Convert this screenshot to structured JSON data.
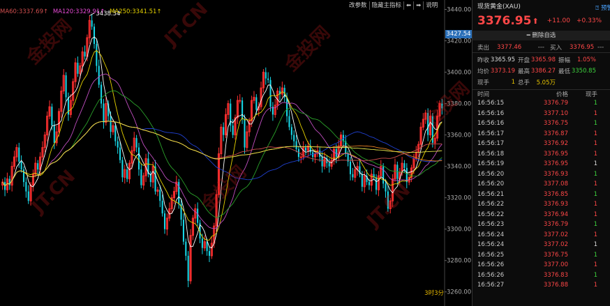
{
  "chart_data": {
    "type": "candlestick",
    "ma_legend": [
      {
        "label": "MA60:3337.69↑",
        "color": "#d04e4e"
      },
      {
        "label": "MA120:3329.91↑",
        "color": "#e64ad4"
      },
      {
        "label": "MA250:3341.51↑",
        "color": "#e6d200"
      }
    ],
    "y_ticks": [
      3260,
      3280,
      3300,
      3320,
      3340,
      3360,
      3380,
      3400,
      3420,
      3440
    ],
    "y_tick_labels": [
      "3260.00",
      "3280.00",
      "3300.00",
      "3320.00",
      "3340.00",
      "3360.00",
      "3380.00",
      "3400.00",
      "3420.00",
      "3440.00"
    ],
    "ylim": [
      3251,
      3446
    ],
    "current_price_tag": "3427.54",
    "high_annotation": "3438.54",
    "period_badge": "3时3分",
    "close": [
      3330,
      3325,
      3332,
      3328,
      3340,
      3346,
      3352,
      3343,
      3338,
      3330,
      3324,
      3318,
      3328,
      3335,
      3342,
      3338,
      3346,
      3352,
      3360,
      3372,
      3378,
      3366,
      3355,
      3362,
      3375,
      3388,
      3398,
      3384,
      3373,
      3382,
      3394,
      3406,
      3399,
      3404,
      3413,
      3410,
      3422,
      3433,
      3429,
      3418,
      3404,
      3392,
      3380,
      3368,
      3380,
      3372,
      3362,
      3366,
      3356,
      3352,
      3344,
      3333,
      3338,
      3332,
      3342,
      3350,
      3358,
      3352,
      3338,
      3328,
      3334,
      3345,
      3335,
      3330,
      3340,
      3324,
      3325,
      3318,
      3310,
      3300,
      3307,
      3313,
      3320,
      3324,
      3330,
      3316,
      3306,
      3292,
      3283,
      3267,
      3296,
      3307,
      3313,
      3304,
      3294,
      3288,
      3292,
      3286,
      3283,
      3291,
      3302,
      3322,
      3348,
      3365,
      3360,
      3373,
      3380,
      3366,
      3360,
      3371,
      3382,
      3382,
      3370,
      3352,
      3362,
      3369,
      3382,
      3384,
      3376,
      3378,
      3390,
      3400,
      3396,
      3395,
      3378,
      3373,
      3379,
      3388,
      3386,
      3390,
      3384,
      3372,
      3365,
      3360,
      3356,
      3351,
      3346,
      3346,
      3352,
      3350,
      3353,
      3349,
      3346,
      3348,
      3350,
      3346,
      3340,
      3345,
      3342,
      3340,
      3344,
      3351,
      3346,
      3353,
      3360,
      3356,
      3348,
      3343,
      3335,
      3333,
      3338,
      3340,
      3335,
      3327,
      3334,
      3330,
      3328,
      3335,
      3333,
      3325,
      3334,
      3340,
      3329,
      3324,
      3313,
      3318,
      3332,
      3341,
      3332,
      3336,
      3342,
      3339,
      3330,
      3333,
      3339,
      3345,
      3349,
      3354,
      3365,
      3370,
      3374,
      3360,
      3372,
      3355,
      3358,
      3372,
      3380,
      3377
    ]
  },
  "toolbar": {
    "params": "改参数",
    "hide_main": "隐藏主指标",
    "help": "说明"
  },
  "quote": {
    "name": "现货黄金(XAU)",
    "alert": "预警",
    "price": "3376.95",
    "arrow": "⬆",
    "change": "+11.00",
    "change_pct": "+0.33%",
    "remove_watch": "删除自选",
    "sell_label": "卖出",
    "sell_price": "3377.46",
    "sell_qty": "---",
    "buy_label": "买入",
    "buy_price": "3376.95",
    "buy_qty": "---",
    "stats": [
      {
        "l1": "昨收",
        "v1": "3365.95",
        "c1": "white",
        "l2": "开盘",
        "v2": "3365.98",
        "c2": "red",
        "l3": "振幅",
        "v3": "1.05%",
        "c3": "red"
      },
      {
        "l1": "均价",
        "v1": "3373.19",
        "c1": "red",
        "l2": "最高",
        "v2": "3386.27",
        "c2": "red",
        "l3": "最低",
        "v3": "3350.85",
        "c3": "green"
      },
      {
        "l1": "现手",
        "v1": "1",
        "c1": "yellow",
        "l2": "总手",
        "v2": "5.05万",
        "c2": "yellow",
        "l3": "",
        "v3": "",
        "c3": "white"
      }
    ],
    "ticks_header": {
      "time": "时间",
      "price": "价格",
      "vol": "现手"
    },
    "ticks": [
      {
        "time": "16:56:15",
        "price": "3376.79",
        "vol": "1",
        "pc": "red",
        "vc": "green"
      },
      {
        "time": "16:56:16",
        "price": "3377.10",
        "vol": "1",
        "pc": "red",
        "vc": "red"
      },
      {
        "time": "16:56:16",
        "price": "3376.75",
        "vol": "1",
        "pc": "red",
        "vc": "green"
      },
      {
        "time": "16:56:17",
        "price": "3376.87",
        "vol": "1",
        "pc": "red",
        "vc": "red"
      },
      {
        "time": "16:56:17",
        "price": "3376.92",
        "vol": "1",
        "pc": "red",
        "vc": "red"
      },
      {
        "time": "16:56:18",
        "price": "3376.95",
        "vol": "1",
        "pc": "red",
        "vc": "red"
      },
      {
        "time": "16:56:19",
        "price": "3376.95",
        "vol": "1",
        "pc": "red",
        "vc": "white"
      },
      {
        "time": "16:56:20",
        "price": "3376.93",
        "vol": "1",
        "pc": "red",
        "vc": "green"
      },
      {
        "time": "16:56:20",
        "price": "3377.08",
        "vol": "1",
        "pc": "red",
        "vc": "red"
      },
      {
        "time": "16:56:21",
        "price": "3376.85",
        "vol": "1",
        "pc": "red",
        "vc": "green"
      },
      {
        "time": "16:56:22",
        "price": "3376.93",
        "vol": "1",
        "pc": "red",
        "vc": "red"
      },
      {
        "time": "16:56:22",
        "price": "3376.94",
        "vol": "1",
        "pc": "red",
        "vc": "red"
      },
      {
        "time": "16:56:23",
        "price": "3376.79",
        "vol": "1",
        "pc": "red",
        "vc": "green"
      },
      {
        "time": "16:56:24",
        "price": "3377.02",
        "vol": "1",
        "pc": "red",
        "vc": "red"
      },
      {
        "time": "16:56:24",
        "price": "3377.02",
        "vol": "1",
        "pc": "red",
        "vc": "white"
      },
      {
        "time": "16:56:25",
        "price": "3376.75",
        "vol": "1",
        "pc": "red",
        "vc": "green"
      },
      {
        "time": "16:56:26",
        "price": "3377.00",
        "vol": "1",
        "pc": "red",
        "vc": "red"
      },
      {
        "time": "16:56:26",
        "price": "3376.83",
        "vol": "1",
        "pc": "red",
        "vc": "green"
      },
      {
        "time": "16:56:27",
        "price": "3376.88",
        "vol": "1",
        "pc": "red",
        "vc": "red"
      }
    ]
  },
  "watermark": {
    "text": "金投网",
    "text2": "JT.CN"
  }
}
